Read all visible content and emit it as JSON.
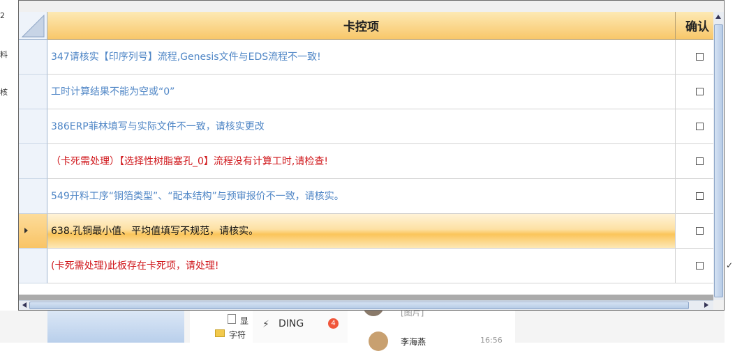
{
  "background": {
    "left_texts": [
      "2",
      "料",
      "核"
    ],
    "tree_items": [
      "显",
      "字符"
    ],
    "ding_label": "DING",
    "ding_badge": "4",
    "chat_top_text": "[图片]",
    "chat_name": "李海燕",
    "chat_time": "16:56"
  },
  "grid": {
    "columns": {
      "item": "卡控项",
      "confirm": "确认"
    },
    "rows": [
      {
        "text": "347请核实【印序列号】流程,Genesis文件与EDS流程不一致!",
        "color": "blue",
        "checked": false,
        "selected": false
      },
      {
        "text": "工时计算结果不能为空或“0”",
        "color": "blue",
        "checked": false,
        "selected": false
      },
      {
        "text": "386ERP菲林填写与实际文件不一致，请核实更改",
        "color": "blue",
        "checked": false,
        "selected": false
      },
      {
        "text": "（卡死需处理）【选择性树脂塞孔_0】流程没有计算工时,请检查!",
        "color": "red",
        "checked": false,
        "selected": false
      },
      {
        "text": "549开料工序“铜箔类型”、“配本结构”与预审报价不一致，请核实。",
        "color": "blue",
        "checked": false,
        "selected": false
      },
      {
        "text": "638.孔铜最小值、平均值填写不规范，请核实。",
        "color": "black",
        "checked": false,
        "selected": true
      },
      {
        "text": "(卡死需处理)此板存在卡死项，请处理!",
        "color": "red",
        "checked": false,
        "selected": false
      }
    ]
  },
  "colors": {
    "header_gradient_top": "#fde9b4",
    "header_gradient_bottom": "#f8c76a",
    "blue_text": "#4f86c6",
    "red_text": "#d0181c",
    "selected_row": "#fbc55a"
  }
}
